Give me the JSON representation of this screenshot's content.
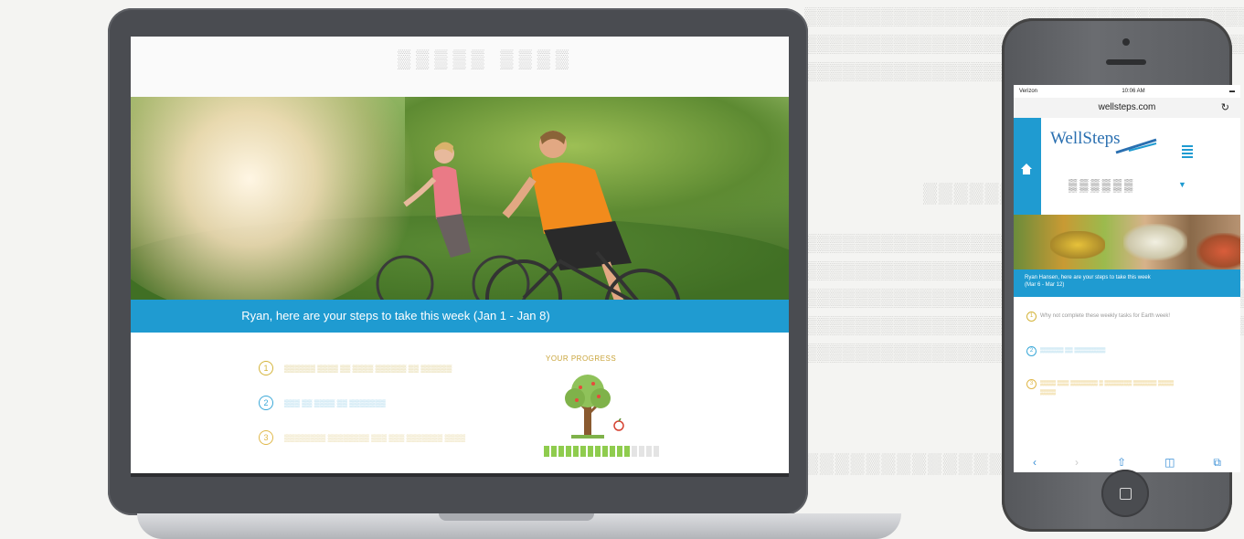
{
  "laptop": {
    "banner_text": "Ryan, here are your steps to take this week (Jan 1 - Jan 8)",
    "progress_label": "YOUR PROGRESS",
    "tasks": [
      {
        "number": "1",
        "color": "#d4b43a"
      },
      {
        "number": "2",
        "color": "#3aa8d8"
      },
      {
        "number": "3",
        "color": "#e0b84a"
      }
    ],
    "progress_fraction": 0.75
  },
  "phone": {
    "status_carrier": "Verizon",
    "status_time": "10:06 AM",
    "url": "wellsteps.com",
    "logo": "WellSteps",
    "banner_text": "Ryan Hansen, here are your steps to take this week",
    "banner_dates": "(Mar 6 - Mar 12)",
    "tasks": [
      {
        "number": "1",
        "color": "#d4b43a",
        "text": "Why not complete these weekly tasks for Earth week!"
      },
      {
        "number": "2",
        "color": "#3aa8d8"
      },
      {
        "number": "3",
        "color": "#e0b84a"
      }
    ]
  },
  "icons": [
    "home-icon",
    "hamburger-menu-icon",
    "reload-icon",
    "back-icon",
    "share-icon",
    "bookmarks-icon",
    "tabs-icon",
    "tree-icon",
    "apple-icon"
  ]
}
